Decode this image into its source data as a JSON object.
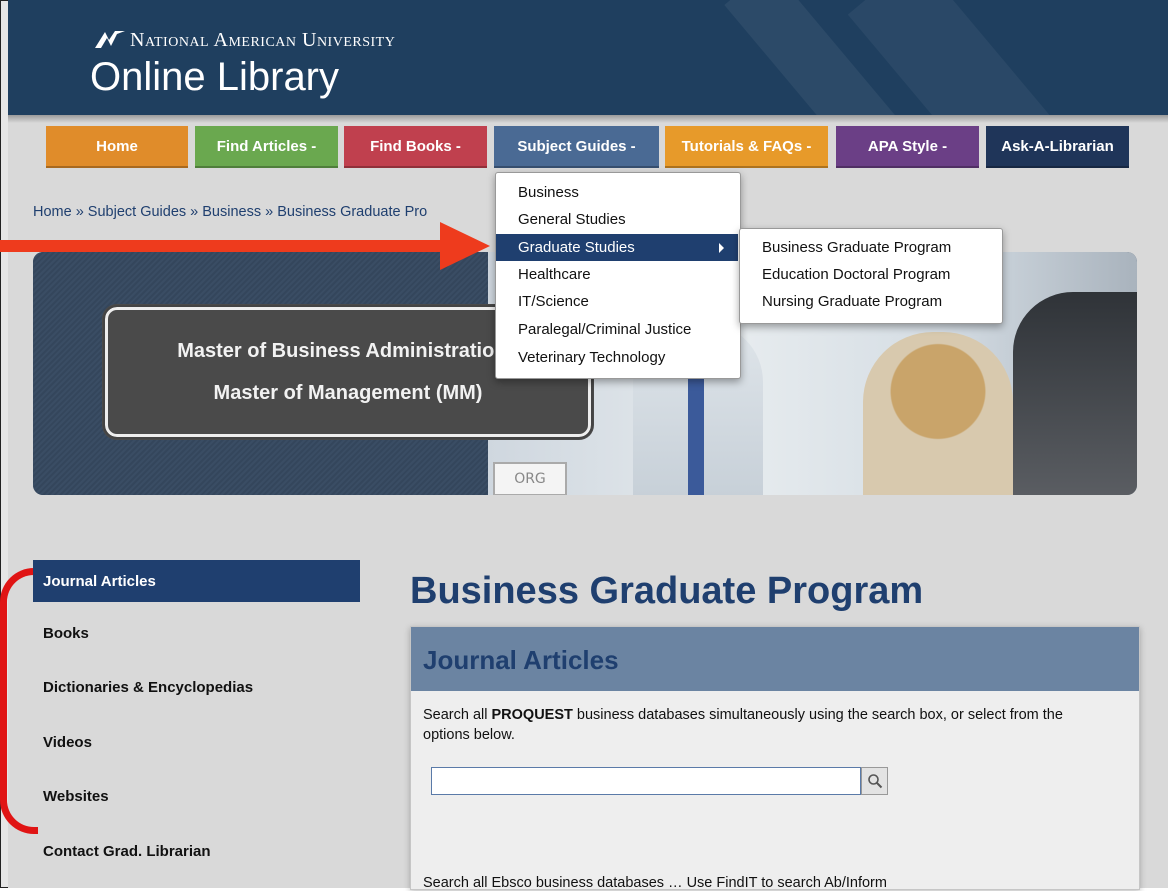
{
  "header": {
    "university": "National American University",
    "library": "Online Library"
  },
  "nav": {
    "items": [
      {
        "label": "Home",
        "color": "#e08c2a"
      },
      {
        "label": "Find Articles -",
        "color": "#6aa84f"
      },
      {
        "label": "Find Books -",
        "color": "#c0404e"
      },
      {
        "label": "Subject Guides -",
        "color": "#4a6a94"
      },
      {
        "label": "Tutorials & FAQs -",
        "color": "#e79a2a"
      },
      {
        "label": "APA Style -",
        "color": "#6b3f86"
      },
      {
        "label": "Ask-A-Librarian",
        "color": "#1f3559"
      }
    ]
  },
  "breadcrumb": "Home » Subject Guides » Business » Business Graduate Pro",
  "banner": {
    "line1": "Master of Business Administration (",
    "line2": "Master of Management (MM)",
    "board_text": "ORG"
  },
  "dropdown": {
    "items": [
      "Business",
      "General Studies",
      "Graduate Studies",
      "Healthcare",
      "IT/Science",
      "Paralegal/Criminal Justice",
      "Veterinary Technology"
    ],
    "active_index": 2
  },
  "submenu": {
    "items": [
      "Business Graduate Program",
      "Education Doctoral Program",
      "Nursing Graduate Program"
    ]
  },
  "sidebar": {
    "items": [
      "Journal Articles",
      "Books",
      "Dictionaries & Encyclopedias",
      "Videos",
      "Websites",
      "Contact Grad. Librarian"
    ]
  },
  "main": {
    "title": "Business Graduate Program",
    "panel_title": "Journal Articles",
    "intro_pre": "Search all ",
    "intro_bold": "PROQUEST",
    "intro_post": " business databases simultaneously using the search box, or select from the options below.",
    "search_value": "",
    "footer_text": "Search all Ebsco business databases …  Use FindIT to search Ab/Inform"
  },
  "colors": {
    "header_bg": "#1f3f5f",
    "accent": "#1f3f6f",
    "annotation_red": "#e01414"
  }
}
